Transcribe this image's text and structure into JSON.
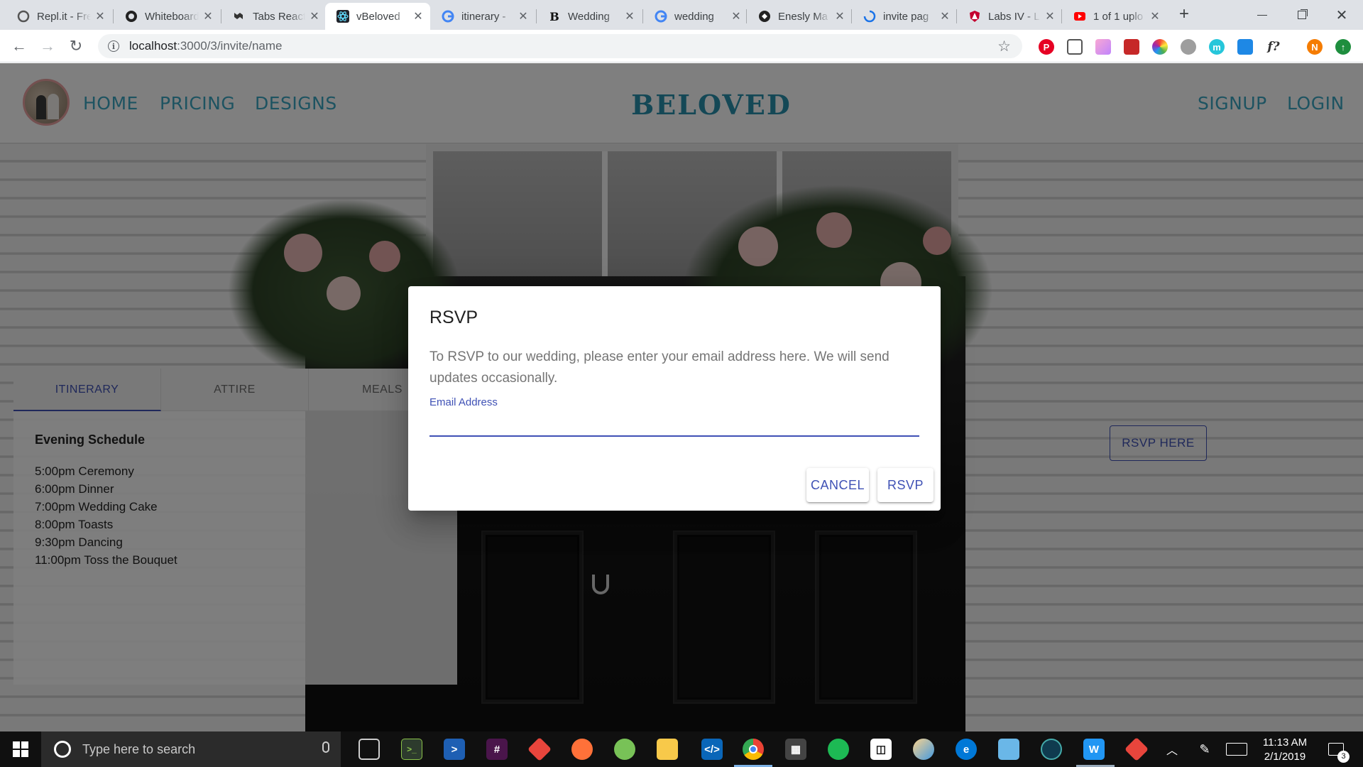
{
  "browser": {
    "tabs": [
      {
        "title": "Repl.it - Free",
        "icon": "replit-icon",
        "active": false
      },
      {
        "title": "Whiteboard",
        "icon": "github-icon",
        "active": false
      },
      {
        "title": "Tabs React",
        "icon": "material-ui-icon",
        "active": false
      },
      {
        "title": "vBeloved",
        "icon": "react-icon",
        "active": true
      },
      {
        "title": "itinerary -",
        "icon": "google-icon",
        "active": false
      },
      {
        "title": "Wedding",
        "icon": "bold-b-icon",
        "active": false
      },
      {
        "title": "wedding",
        "icon": "google-icon",
        "active": false
      },
      {
        "title": "Enesly Ma",
        "icon": "enesly-icon",
        "active": false
      },
      {
        "title": "invite pag",
        "icon": "loading-icon",
        "active": false
      },
      {
        "title": "Labs IV - L",
        "icon": "shield-icon",
        "active": false
      },
      {
        "title": "1 of 1 uplo",
        "icon": "youtube-icon",
        "active": false
      }
    ],
    "new_tab": "+",
    "url_host": "localhost",
    "url_rest": ":3000/3/invite/name"
  },
  "site": {
    "brand": "BELOVED",
    "nav_left": [
      "HOME",
      "PRICING",
      "DESIGNS"
    ],
    "nav_right": [
      "SIGNUP",
      "LOGIN"
    ],
    "tabs": [
      {
        "label": "ITINERARY",
        "selected": true
      },
      {
        "label": "ATTIRE",
        "selected": false
      },
      {
        "label": "MEALS",
        "selected": false
      }
    ],
    "schedule_title": "Evening Schedule",
    "schedule": [
      "5:00pm Ceremony",
      "6:00pm Dinner",
      "7:00pm Wedding Cake",
      "8:00pm Toasts",
      "9:30pm Dancing",
      "11:00pm Toss the Bouquet"
    ],
    "rsvp_here": "RSVP HERE"
  },
  "dialog": {
    "title": "RSVP",
    "text": "To RSVP to our wedding, please enter your email address here. We will send updates occasionally.",
    "field_label": "Email Address",
    "field_value": "",
    "cancel": "CANCEL",
    "submit": "RSVP"
  },
  "taskbar": {
    "search_placeholder": "Type here to search",
    "time": "11:13 AM",
    "date": "2/1/2019",
    "notification_count": "3"
  },
  "colors": {
    "primary": "#3f51b5",
    "nav_link": "#3aa7c2",
    "brand": "#2890ad"
  }
}
